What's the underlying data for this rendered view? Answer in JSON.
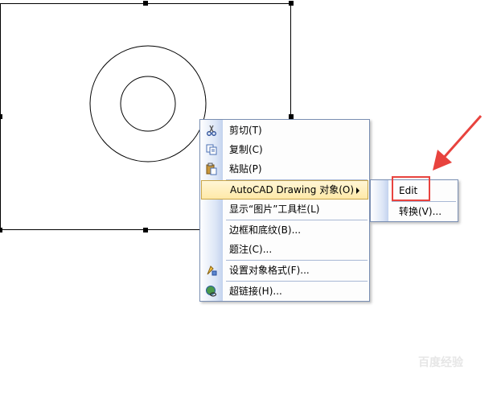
{
  "context_menu": {
    "items": [
      {
        "label": "剪切(T)",
        "icon": "scissors-icon"
      },
      {
        "label": "复制(C)",
        "icon": "copy-icon"
      },
      {
        "label": "粘贴(P)",
        "icon": "paste-icon"
      },
      {
        "label": "AutoCAD Drawing 对象(O)",
        "icon": "",
        "has_submenu": true,
        "highlighted": true
      },
      {
        "label": "显示“图片”工具栏(L)",
        "icon": ""
      },
      {
        "label": "边框和底纹(B)...",
        "icon": ""
      },
      {
        "label": "题注(C)...",
        "icon": ""
      },
      {
        "label": "设置对象格式(F)...",
        "icon": "format-object-icon"
      },
      {
        "label": "超链接(H)...",
        "icon": "hyperlink-icon"
      }
    ]
  },
  "submenu": {
    "items": [
      {
        "label": "Edit"
      },
      {
        "label": "转换(V)..."
      }
    ]
  },
  "annotation": {
    "color": "#e8433e"
  },
  "watermark": {
    "text": "百度经验"
  }
}
